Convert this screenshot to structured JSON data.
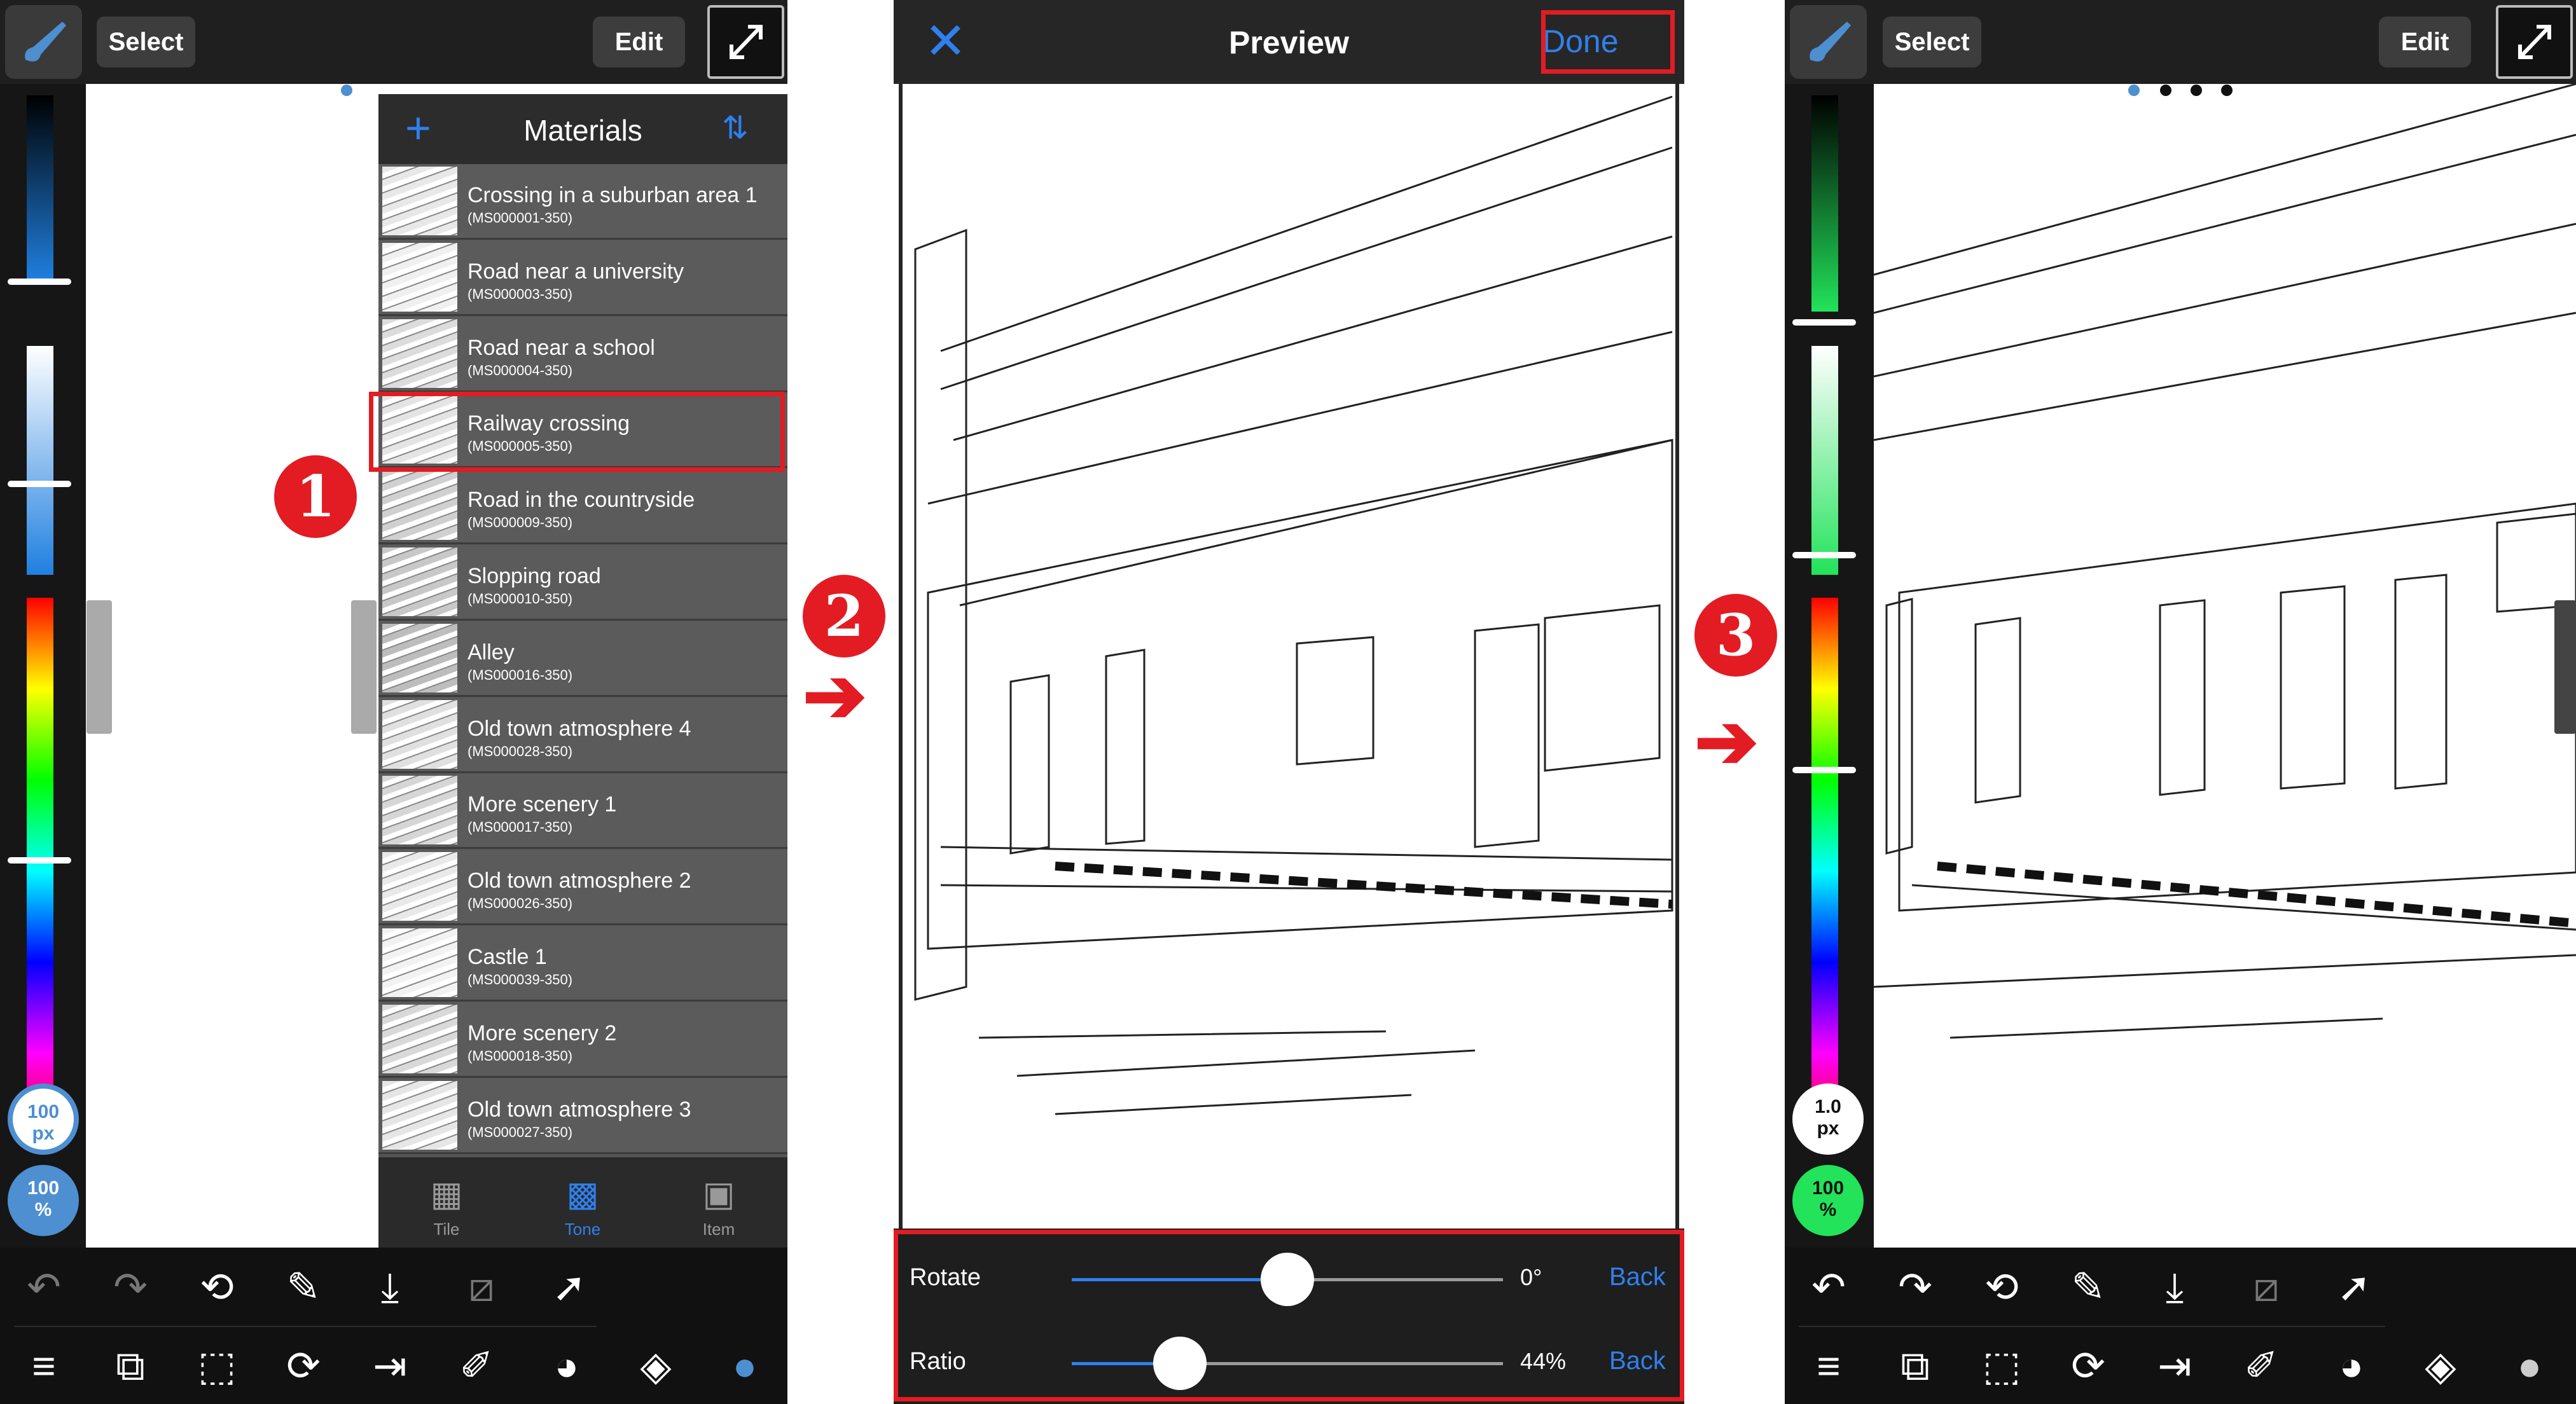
{
  "panel1": {
    "select_label": "Select",
    "edit_label": "Edit",
    "brush_size": "100\npx",
    "opacity": "100\n%",
    "materials": {
      "title": "Materials",
      "items": [
        {
          "name": "Crossing in a suburban area 1",
          "code": "(MS000001-350)"
        },
        {
          "name": "Road near a university",
          "code": "(MS000003-350)"
        },
        {
          "name": "Road near a school",
          "code": "(MS000004-350)"
        },
        {
          "name": "Railway crossing",
          "code": "(MS000005-350)"
        },
        {
          "name": "Road in the countryside",
          "code": "(MS000009-350)"
        },
        {
          "name": "Slopping road",
          "code": "(MS000010-350)"
        },
        {
          "name": "Alley",
          "code": "(MS000016-350)"
        },
        {
          "name": "Old town atmosphere 4",
          "code": "(MS000028-350)"
        },
        {
          "name": "More scenery 1",
          "code": "(MS000017-350)"
        },
        {
          "name": "Old town atmosphere 2",
          "code": "(MS000026-350)"
        },
        {
          "name": "Castle 1",
          "code": "(MS000039-350)"
        },
        {
          "name": "More scenery 2",
          "code": "(MS000018-350)"
        },
        {
          "name": "Old town atmosphere 3",
          "code": "(MS000027-350)"
        }
      ],
      "tabs": [
        {
          "label": "Tile",
          "active": false
        },
        {
          "label": "Tone",
          "active": true
        },
        {
          "label": "Item",
          "active": false
        }
      ]
    }
  },
  "panel2": {
    "title": "Preview",
    "done_label": "Done",
    "rotate": {
      "label": "Rotate",
      "value": "0°",
      "back": "Back",
      "level": 0.5
    },
    "ratio": {
      "label": "Ratio",
      "value": "44%",
      "back": "Back",
      "level": 0.25
    }
  },
  "panel3": {
    "select_label": "Select",
    "edit_label": "Edit",
    "brush_size": "1.0\npx",
    "opacity": "100\n%"
  },
  "annotations": {
    "step1": "1",
    "step2": "2",
    "step3": "3"
  },
  "colors": {
    "accent_blue": "#2f80ed",
    "annotation_red": "#e31b23",
    "opacity_green": "#22e35a",
    "brush_blue": "#4d8fd1"
  },
  "icons": [
    "brush-icon",
    "expand-icon",
    "undo-icon",
    "redo-icon",
    "lasso-icon",
    "eyedropper-icon",
    "import-icon",
    "transform-icon",
    "menu-icon",
    "layers-copy-icon",
    "selection-icon",
    "rotate-icon",
    "ruler-icon",
    "palette-icon",
    "layers-icon",
    "chat-icon",
    "plus-icon",
    "sort-icon",
    "close-icon"
  ]
}
